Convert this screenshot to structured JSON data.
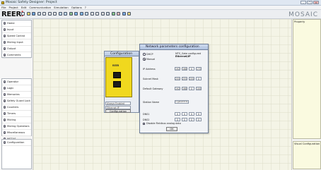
{
  "window": {
    "title": "Mosaic Safety Designer: Project"
  },
  "menu": [
    "File",
    "Project",
    "Edit",
    "Communication",
    "Simulation",
    "Options",
    "?"
  ],
  "brand": {
    "logo_main": "REER",
    "logo_accent": "i",
    "app_name": "MOSAIC"
  },
  "toolbar_icons": [
    "new-icon",
    "open-icon",
    "save-icon",
    "print-icon",
    "cut-icon",
    "copy-icon",
    "paste-icon",
    "undo-icon",
    "redo-icon",
    "connect-icon",
    "download-icon",
    "upload-icon",
    "monitor-icon",
    "zoom-in-icon",
    "zoom-out-icon",
    "grid-icon",
    "settings-icon",
    "validate-icon",
    "report-icon",
    "simulate-icon",
    "help-icon"
  ],
  "left_top": [
    "Home",
    "Input",
    "Speed Control",
    "Muting Input",
    "Output",
    "Comments"
  ],
  "left_mid": [
    "Operator",
    "Logic",
    "Memories",
    "Safety Guard Lock",
    "Counters",
    "Timers",
    "Muting",
    "Muting Operators",
    "Miscellaneous",
    "MSTUS"
  ],
  "left_bottom": [
    "Configuration"
  ],
  "right": {
    "property": "Property",
    "visual": "Visual Configuration"
  },
  "config_window": {
    "title": "Configuration",
    "tag": "M1",
    "device_logo": "REER",
    "dropdown": "Always Enabled",
    "field2": "Ethernet IP",
    "button": "Configuration"
  },
  "net_dialog": {
    "title": "Network parameters configuration",
    "dhcp": "DHCP",
    "manual": "Manual",
    "info_line1": "MTS_Gate configured",
    "info_line2": "Ethernet/IP",
    "ip_label": "IP Address",
    "ip": [
      "192",
      "168",
      "0",
      "172"
    ],
    "subnet_label": "Subnet Mask",
    "subnet": [
      "255",
      "255",
      "255",
      "0"
    ],
    "gateway_label": "Default Gateway",
    "gateway": [
      "192",
      "168",
      "0",
      "100"
    ],
    "station_label": "Station Name",
    "station": "Ingate1Di1te",
    "dns1_label": "DNS1",
    "dns1": [
      "0",
      "0",
      "0",
      "0"
    ],
    "dns2_label": "DNS2",
    "dns2": [
      "0",
      "0",
      "0",
      "0"
    ],
    "fieldbus_label": "Disable Fieldbus analog data",
    "ok": "OK"
  }
}
